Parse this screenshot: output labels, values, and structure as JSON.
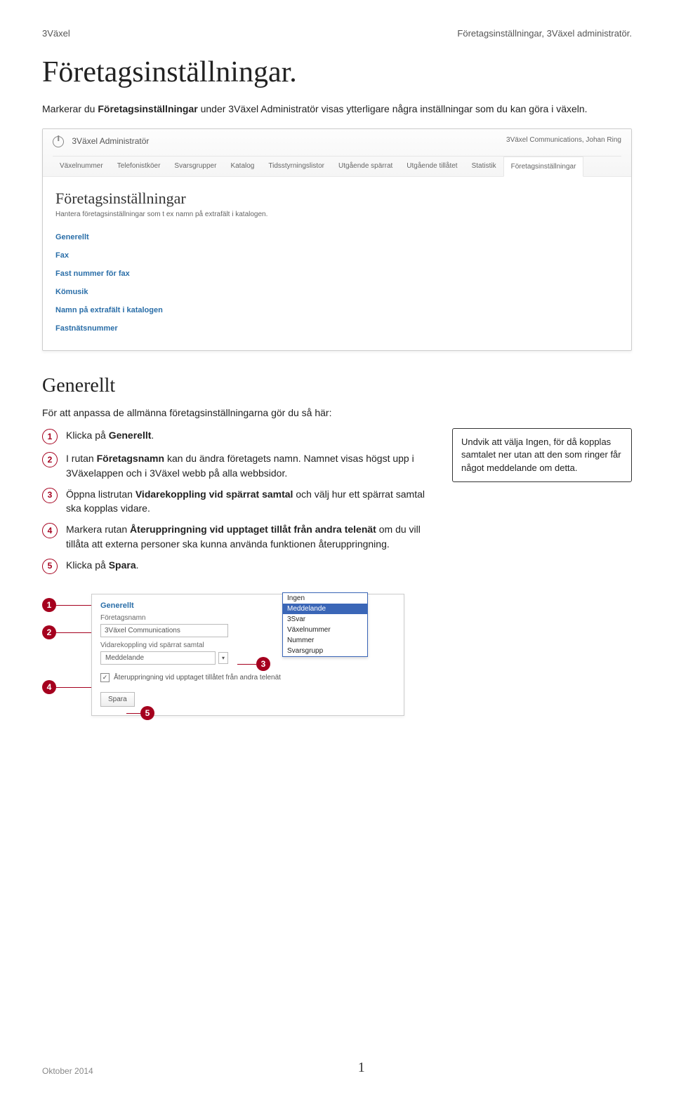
{
  "header": {
    "left": "3Växel",
    "right": "Företagsinställningar, 3Växel administratör."
  },
  "doc_title": "Företagsinställningar.",
  "intro": {
    "pre": "Markerar du ",
    "bold": "Företagsinställningar",
    "post": " under 3Växel Administratör visas ytterligare några inställningar som du kan göra i växeln."
  },
  "app": {
    "title": "3Växel Administratör",
    "user": "3Växel Communications, Johan Ring",
    "nav": [
      "Växelnummer",
      "Telefonistköer",
      "Svarsgrupper",
      "Katalog",
      "Tidsstyrningslistor",
      "Utgående spärrat",
      "Utgående tillåtet",
      "Statistik",
      "Företagsinställningar"
    ],
    "panel_title": "Företagsinställningar",
    "panel_sub": "Hantera företagsinställningar som t ex namn på extrafält i katalogen.",
    "links": [
      "Generellt",
      "Fax",
      "Fast nummer för fax",
      "Kömusik",
      "Namn på extrafält i katalogen",
      "Fastnätsnummer"
    ]
  },
  "sec_title": "Generellt",
  "sec_lead": "För att anpassa de allmänna företagsinställningarna gör du så här:",
  "steps": {
    "1": {
      "a": "Klicka på ",
      "b": "Generellt",
      "c": "."
    },
    "2": {
      "a": "I rutan ",
      "b": "Företagsnamn",
      "c": " kan du ändra företagets namn. Namnet visas högst upp i 3Växelappen och i 3Växel webb på alla webbsidor."
    },
    "3": {
      "a": "Öppna listrutan ",
      "b": "Vidarekoppling vid spärrat samtal",
      "c": " och välj hur ett spärrat samtal ska kopplas vidare."
    },
    "4": {
      "a": "Markera rutan ",
      "b": "Återuppringning vid upptaget tillåt från andra telenät",
      "c": " om du vill tillåta att externa personer ska kunna använda funktionen återuppringning."
    },
    "5": {
      "a": "Klicka på ",
      "b": "Spara",
      "c": "."
    }
  },
  "sidebox": "Undvik att välja Ingen, för då kopplas samtalet ner utan att den som ringer får något meddelande om detta.",
  "panel2": {
    "title": "Generellt",
    "label1": "Företagsnamn",
    "value1": "3Växel Communications",
    "label2": "Vidarekoppling vid spärrat samtal",
    "select_value": "Meddelande",
    "check_label": "Återuppringning vid upptaget tillåtet från andra telenät",
    "button": "Spara",
    "dropdown": [
      "Ingen",
      "Meddelande",
      "3Svar",
      "Växelnummer",
      "Nummer",
      "Svarsgrupp"
    ]
  },
  "callouts": [
    "1",
    "2",
    "3",
    "4",
    "5"
  ],
  "footer": {
    "left": "Oktober 2014",
    "page": "1"
  }
}
